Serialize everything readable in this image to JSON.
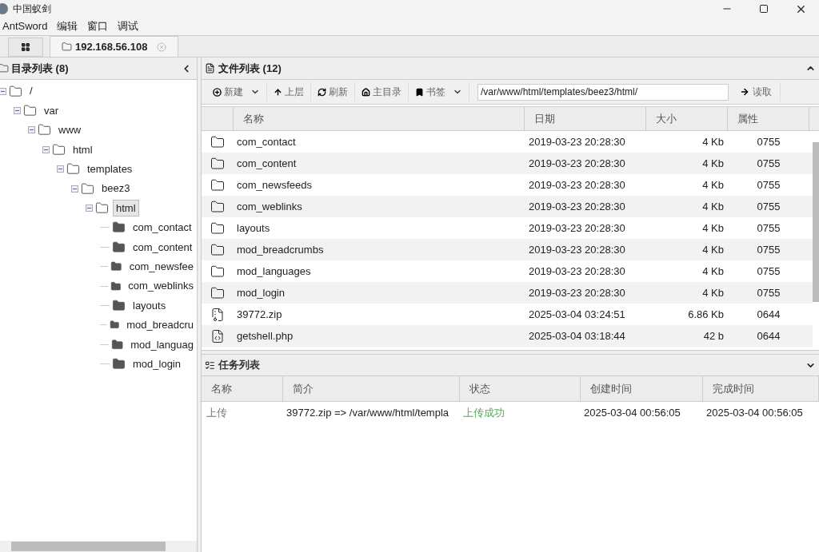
{
  "window": {
    "title": "中国蚁剑"
  },
  "menu": [
    "AntSword",
    "编辑",
    "窗口",
    "调试"
  ],
  "tabs": [
    {
      "label": "192.168.56.108",
      "selected": true
    }
  ],
  "dir_panel": {
    "title": "目录列表 (8)",
    "tree": [
      {
        "label": "/",
        "expanded": true,
        "selected": false,
        "children": [
          {
            "label": "var",
            "expanded": true,
            "selected": false,
            "children": [
              {
                "label": "www",
                "expanded": true,
                "selected": false,
                "children": [
                  {
                    "label": "html",
                    "expanded": true,
                    "selected": false,
                    "children": [
                      {
                        "label": "templates",
                        "expanded": true,
                        "selected": false,
                        "children": [
                          {
                            "label": "beez3",
                            "expanded": true,
                            "selected": false,
                            "children": [
                              {
                                "label": "html",
                                "expanded": true,
                                "selected": true,
                                "children": [
                                  {
                                    "label": "com_contact",
                                    "selected": false
                                  },
                                  {
                                    "label": "com_content",
                                    "selected": false
                                  },
                                  {
                                    "label": "com_newsfee",
                                    "selected": false
                                  },
                                  {
                                    "label": "com_weblinks",
                                    "selected": false
                                  },
                                  {
                                    "label": "layouts",
                                    "selected": false
                                  },
                                  {
                                    "label": "mod_breadcru",
                                    "selected": false
                                  },
                                  {
                                    "label": "mod_languag",
                                    "selected": false
                                  },
                                  {
                                    "label": "mod_login",
                                    "selected": false
                                  }
                                ]
                              }
                            ]
                          }
                        ]
                      }
                    ]
                  }
                ]
              }
            ]
          }
        ]
      }
    ]
  },
  "file_panel": {
    "title": "文件列表 (12)",
    "toolbar": [
      {
        "label": "新建",
        "kind": "new",
        "dropdown": true
      },
      {
        "label": "上层",
        "kind": "up",
        "dropdown": false
      },
      {
        "label": "刷新",
        "kind": "refresh",
        "dropdown": false
      },
      {
        "label": "主目录",
        "kind": "home",
        "dropdown": false
      },
      {
        "label": "书签",
        "kind": "bookmark",
        "dropdown": true
      }
    ],
    "path": "/var/www/html/templates/beez3/html/",
    "read_button": "读取",
    "columns": [
      "名称",
      "日期",
      "大小",
      "属性"
    ],
    "rows": [
      {
        "kind": "folder",
        "name": "com_contact",
        "date": "2019-03-23 20:28:30",
        "size": "4 Kb",
        "perm": "0755"
      },
      {
        "kind": "folder",
        "name": "com_content",
        "date": "2019-03-23 20:28:30",
        "size": "4 Kb",
        "perm": "0755"
      },
      {
        "kind": "folder",
        "name": "com_newsfeeds",
        "date": "2019-03-23 20:28:30",
        "size": "4 Kb",
        "perm": "0755"
      },
      {
        "kind": "folder",
        "name": "com_weblinks",
        "date": "2019-03-23 20:28:30",
        "size": "4 Kb",
        "perm": "0755"
      },
      {
        "kind": "folder",
        "name": "layouts",
        "date": "2019-03-23 20:28:30",
        "size": "4 Kb",
        "perm": "0755"
      },
      {
        "kind": "folder",
        "name": "mod_breadcrumbs",
        "date": "2019-03-23 20:28:30",
        "size": "4 Kb",
        "perm": "0755"
      },
      {
        "kind": "folder",
        "name": "mod_languages",
        "date": "2019-03-23 20:28:30",
        "size": "4 Kb",
        "perm": "0755"
      },
      {
        "kind": "folder",
        "name": "mod_login",
        "date": "2019-03-23 20:28:30",
        "size": "4 Kb",
        "perm": "0755"
      },
      {
        "kind": "zip",
        "name": "39772.zip",
        "date": "2025-03-04 03:24:51",
        "size": "6.86 Kb",
        "perm": "0644"
      },
      {
        "kind": "code",
        "name": "getshell.php",
        "date": "2025-03-04 03:18:44",
        "size": "42 b",
        "perm": "0644"
      }
    ]
  },
  "task_panel": {
    "title": "任务列表",
    "columns": [
      "名称",
      "简介",
      "状态",
      "创建时间",
      "完成时间"
    ],
    "rows": [
      {
        "name": "上传",
        "brief": "39772.zip => /var/www/html/templa",
        "status": "上传成功",
        "color": "#4caf50",
        "created": "2025-03-04 00:56:05",
        "finished": "2025-03-04 00:56:05"
      }
    ]
  }
}
